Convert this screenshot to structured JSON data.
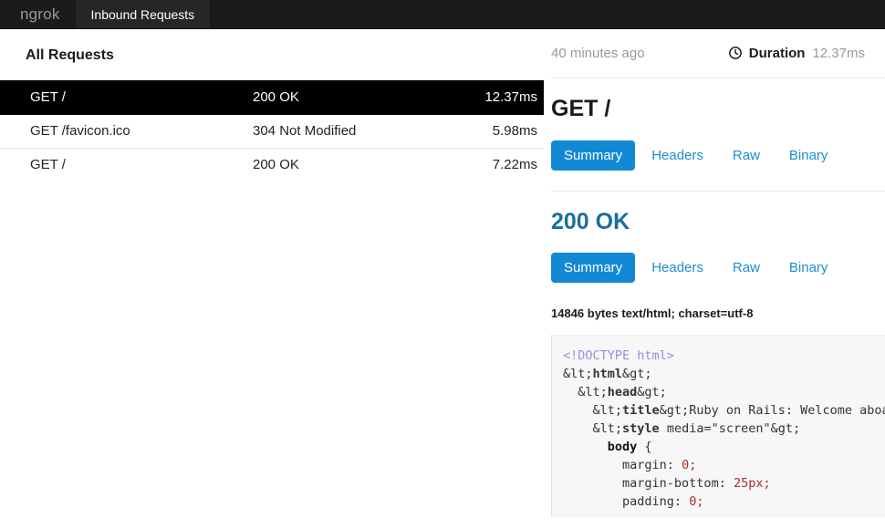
{
  "topnav": {
    "brand": "ngrok",
    "tab_label": "Inbound Requests"
  },
  "left": {
    "section_title": "All Requests",
    "columns": [
      "path",
      "status",
      "duration"
    ],
    "rows": [
      {
        "path": "GET /",
        "status": "200 OK",
        "duration": "12.37ms",
        "selected": true
      },
      {
        "path": "GET /favicon.ico",
        "status": "304 Not Modified",
        "duration": "5.98ms",
        "selected": false
      },
      {
        "path": "GET /",
        "status": "200 OK",
        "duration": "7.22ms",
        "selected": false
      }
    ]
  },
  "right": {
    "meta": {
      "ago": "40 minutes ago",
      "clock_icon": "clock-icon",
      "duration_label": "Duration",
      "duration_value": "12.37ms"
    },
    "request": {
      "title": "GET /",
      "tabs": [
        {
          "label": "Summary",
          "active": true
        },
        {
          "label": "Headers",
          "active": false
        },
        {
          "label": "Raw",
          "active": false
        },
        {
          "label": "Binary",
          "active": false
        }
      ]
    },
    "response": {
      "title": "200 OK",
      "tabs": [
        {
          "label": "Summary",
          "active": true
        },
        {
          "label": "Headers",
          "active": false
        },
        {
          "label": "Raw",
          "active": false
        },
        {
          "label": "Binary",
          "active": false
        }
      ],
      "bytes_line": "14846 bytes text/html; charset=utf-8",
      "body_lines": [
        "<!DOCTYPE html>",
        "<html>",
        "  <head>",
        "    <title>Ruby on Rails: Welcome aboard</title>",
        "    <style media=\"screen\">",
        "      body {",
        "        margin: 0;",
        "        margin-bottom: 25px;",
        "        padding: 0;"
      ]
    }
  },
  "colors": {
    "accent_blue": "#1189d4",
    "link_blue": "#1b8fd1",
    "heading_blue": "#1a6ea0",
    "topnav_bg": "#1b1b1b",
    "tab_bg": "#262626",
    "selected_row_bg": "#000000",
    "code_bg": "#f7f7f7",
    "muted_text": "#999999"
  }
}
